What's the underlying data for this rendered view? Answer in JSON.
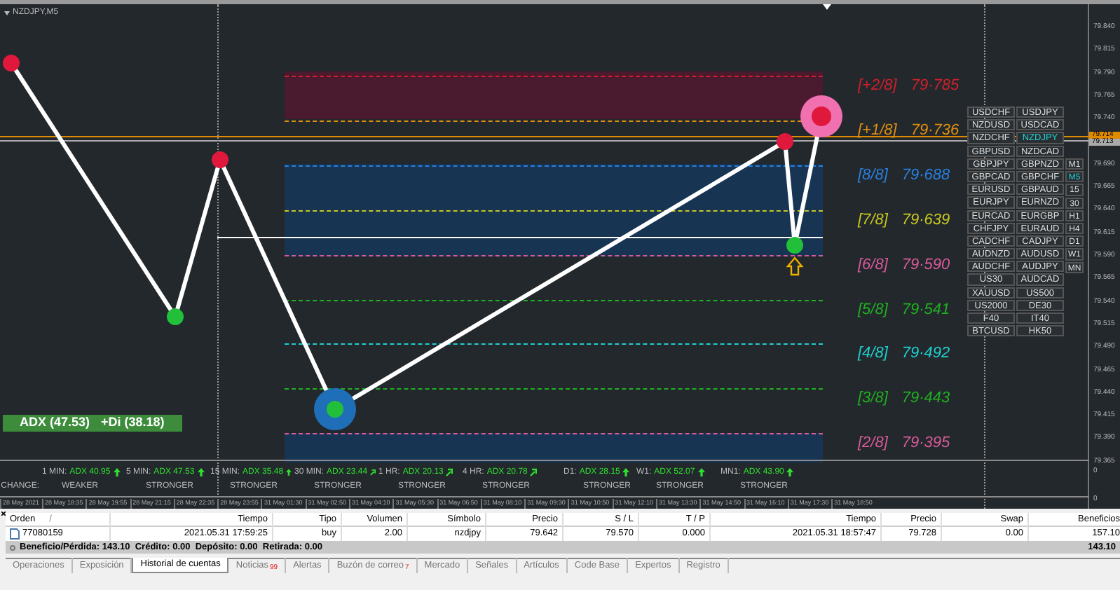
{
  "chart": {
    "title": "NZDJPY,M5",
    "price_axis": [
      "79.840",
      "79.815",
      "79.790",
      "79.765",
      "79.740",
      "79.690",
      "79.665",
      "79.640",
      "79.615",
      "79.590",
      "79.565",
      "79.540",
      "79.515",
      "79.490",
      "79.465",
      "79.440",
      "79.415",
      "79.390",
      "79.365"
    ],
    "price_tags": [
      {
        "text": "79.714",
        "kind": "bid"
      },
      {
        "text": "79.713",
        "kind": "line"
      }
    ],
    "levels": [
      {
        "label": "[+2/8]",
        "price": "79·785",
        "color": "#d0202a"
      },
      {
        "label": "[+1/8]",
        "price": "79·736",
        "color": "#e09010"
      },
      {
        "label": "[8/8]",
        "price": "79·688",
        "color": "#2a80e0"
      },
      {
        "label": "[7/8]",
        "price": "79·639",
        "color": "#c8c820"
      },
      {
        "label": "[6/8]",
        "price": "79·590",
        "color": "#d85a98"
      },
      {
        "label": "[5/8]",
        "price": "79·541",
        "color": "#20b020"
      },
      {
        "label": "[4/8]",
        "price": "79·492",
        "color": "#20d0d0"
      },
      {
        "label": "[3/8]",
        "price": "79·443",
        "color": "#20b020"
      },
      {
        "label": "[2/8]",
        "price": "79·395",
        "color": "#d85a98"
      }
    ],
    "adx_badge": {
      "adx": "ADX (47.53)",
      "di": "+Di (38.18)"
    },
    "adx_panel": {
      "change_label": "CHANGE:",
      "items": [
        {
          "timeframe": "1 MIN:",
          "adx": "ADX 40.95",
          "kind": "up",
          "change": "WEAKER"
        },
        {
          "timeframe": "5 MIN:",
          "adx": "ADX 47.53",
          "kind": "up",
          "change": "STRONGER"
        },
        {
          "timeframe": "15 MIN:",
          "adx": "ADX 35.48",
          "kind": "up",
          "change": "STRONGER"
        },
        {
          "timeframe": "30 MIN:",
          "adx": "ADX 23.44",
          "kind": "rising",
          "change": "STRONGER"
        },
        {
          "timeframe": "1 HR:",
          "adx": "ADX 20.13",
          "kind": "rising",
          "change": "STRONGER"
        },
        {
          "timeframe": "4 HR:",
          "adx": "ADX 20.78",
          "kind": "rising",
          "change": "STRONGER"
        },
        {
          "timeframe": "D1:",
          "adx": "ADX 28.15",
          "kind": "up",
          "change": "STRONGER"
        },
        {
          "timeframe": "W1:",
          "adx": "ADX 52.07",
          "kind": "up",
          "change": "STRONGER"
        },
        {
          "timeframe": "MN1:",
          "adx": "ADX 43.90",
          "kind": "up",
          "change": "STRONGER"
        }
      ]
    },
    "sub_axis": [
      "0",
      "0"
    ],
    "time_axis": [
      "28 May 2021",
      "28 May 18:35",
      "28 May 19:55",
      "28 May 21:15",
      "28 May 22:35",
      "28 May 23:55",
      "31 May 01:30",
      "31 May 02:50",
      "31 May 04:10",
      "31 May 05:30",
      "31 May 06:50",
      "31 May 08:10",
      "31 May 09:30",
      "31 May 10:50",
      "31 May 12:10",
      "31 May 13:30",
      "31 May 14:50",
      "31 May 16:10",
      "31 May 17:30",
      "31 May 18:50"
    ]
  },
  "symbol_panel": {
    "pairs": [
      {
        "label": "USDCHF",
        "selected": false
      },
      {
        "label": "USDJPY",
        "selected": false
      },
      {
        "label": "NZDUSD",
        "selected": false
      },
      {
        "label": "USDCAD",
        "selected": false
      },
      {
        "label": "NZDCHF",
        "selected": false
      },
      {
        "label": "NZDJPY",
        "selected": true
      },
      {
        "label": "GBPUSD",
        "selected": false
      },
      {
        "label": "NZDCAD",
        "selected": false
      },
      {
        "label": "GBPJPY",
        "selected": false
      },
      {
        "label": "GBPNZD",
        "selected": false
      },
      {
        "label": "GBPCAD",
        "selected": false
      },
      {
        "label": "GBPCHF",
        "selected": false
      },
      {
        "label": "EURUSD",
        "selected": false
      },
      {
        "label": "GBPAUD",
        "selected": false
      },
      {
        "label": "EURJPY",
        "selected": false
      },
      {
        "label": "EURNZD",
        "selected": false
      },
      {
        "label": "EURCAD",
        "selected": false
      },
      {
        "label": "EURGBP",
        "selected": false
      },
      {
        "label": "CHFJPY",
        "selected": false
      },
      {
        "label": "EURAUD",
        "selected": false
      },
      {
        "label": "CADCHF",
        "selected": false
      },
      {
        "label": "CADJPY",
        "selected": false
      },
      {
        "label": "AUDNZD",
        "selected": false
      },
      {
        "label": "AUDUSD",
        "selected": false
      },
      {
        "label": "AUDCHF",
        "selected": false
      },
      {
        "label": "AUDJPY",
        "selected": false
      },
      {
        "label": "US30",
        "selected": false
      },
      {
        "label": "AUDCAD",
        "selected": false
      },
      {
        "label": "XAUUSD",
        "selected": false
      },
      {
        "label": "US500",
        "selected": false
      },
      {
        "label": "US2000",
        "selected": false
      },
      {
        "label": "DE30",
        "selected": false
      },
      {
        "label": "F40",
        "selected": false
      },
      {
        "label": "IT40",
        "selected": false
      },
      {
        "label": "BTCUSD",
        "selected": false
      },
      {
        "label": "HK50",
        "selected": false
      }
    ],
    "timeframes": [
      {
        "label": "M1",
        "selected": false
      },
      {
        "label": "M5",
        "selected": true
      },
      {
        "label": "15",
        "selected": false
      },
      {
        "label": "30",
        "selected": false
      },
      {
        "label": "H1",
        "selected": false
      },
      {
        "label": "H4",
        "selected": false
      },
      {
        "label": "D1",
        "selected": false
      },
      {
        "label": "W1",
        "selected": false
      },
      {
        "label": "MN",
        "selected": false
      }
    ]
  },
  "terminal": {
    "columns": [
      "Orden",
      "Tiempo",
      "Tipo",
      "Volumen",
      "Símbolo",
      "Precio",
      "S / L",
      "T / P",
      "Tiempo",
      "Precio",
      "Swap",
      "Beneficios"
    ],
    "sort_mark": "/",
    "rows": [
      [
        "77080159",
        "2021.05.31 17:59:25",
        "buy",
        "2.00",
        "nzdjpy",
        "79.642",
        "79.570",
        "0.000",
        "2021.05.31 18:57:47",
        "79.728",
        "0.00",
        "157.10"
      ]
    ],
    "summary": "Beneficio/Pérdida: 143.10  Crédito: 0.00  Depósito: 0.00  Retirada: 0.00",
    "total": "143.10",
    "tabs": [
      {
        "label": "Operaciones",
        "selected": false
      },
      {
        "label": "Exposición",
        "selected": false
      },
      {
        "label": "Historial de cuentas",
        "selected": true
      },
      {
        "label": "Noticias",
        "selected": false,
        "badge": "99"
      },
      {
        "label": "Alertas",
        "selected": false
      },
      {
        "label": "Buzón de correo",
        "selected": false,
        "badge": "7"
      },
      {
        "label": "Mercado",
        "selected": false
      },
      {
        "label": "Señales",
        "selected": false
      },
      {
        "label": "Artículos",
        "selected": false
      },
      {
        "label": "Code Base",
        "selected": false
      },
      {
        "label": "Expertos",
        "selected": false
      },
      {
        "label": "Registro",
        "selected": false
      }
    ]
  }
}
